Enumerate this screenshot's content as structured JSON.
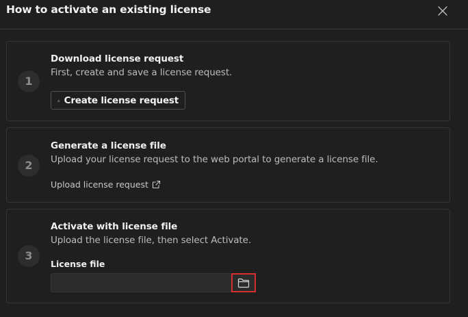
{
  "dialog": {
    "title": "How to activate an existing license"
  },
  "steps": [
    {
      "number": "1",
      "title": "Download license request",
      "description": "First, create and save a license request.",
      "action_label": "Create license request",
      "action_icon": "download-icon"
    },
    {
      "number": "2",
      "title": "Generate a license file",
      "description": "Upload your license request to the web portal to generate a license file.",
      "link_label": "Upload license request",
      "link_icon": "external-link-icon"
    },
    {
      "number": "3",
      "title": "Activate with license file",
      "description": "Upload the license file, then select Activate.",
      "field_label": "License file",
      "field_value": "",
      "browse_icon": "folder-icon",
      "highlight_color": "#d32f2f"
    }
  ]
}
